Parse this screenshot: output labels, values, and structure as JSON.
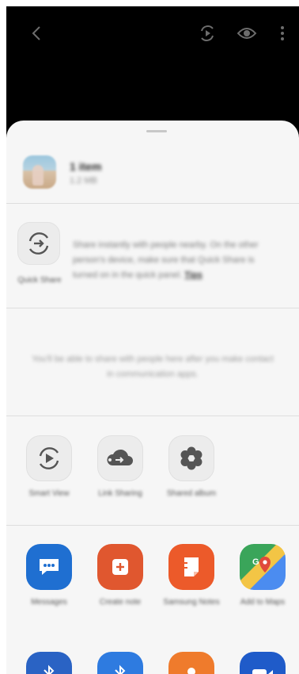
{
  "topbar": {
    "icons": [
      "back-icon",
      "rotate-icon",
      "eye-icon",
      "more-vertical-icon"
    ]
  },
  "file": {
    "title": "1 item",
    "subtitle": "1.2 MB"
  },
  "quick_share": {
    "label": "Quick Share",
    "description": "Share instantly with people nearby. On the other person's device, make sure that Quick Share is turned on in the quick panel.",
    "tips_link": "Tips"
  },
  "contacts": {
    "empty_message": "You'll be able to share with people here after you make contact in communication apps."
  },
  "options": [
    {
      "label": "Smart View",
      "icon": "smart-view-icon"
    },
    {
      "label": "Link Sharing",
      "icon": "link-sharing-icon"
    },
    {
      "label": "Shared album",
      "icon": "shared-album-icon"
    }
  ],
  "apps": [
    {
      "label": "Messages",
      "icon": "messages-icon",
      "color": "#1f6fd1"
    },
    {
      "label": "Create note",
      "icon": "create-note-icon",
      "color": "#e0572f"
    },
    {
      "label": "Samsung Notes",
      "icon": "samsung-notes-icon",
      "color": "#ec5a2a"
    },
    {
      "label": "Add to Maps",
      "icon": "maps-icon",
      "color": "#4aa54a"
    }
  ],
  "apps_row2": [
    {
      "icon": "bluetooth-icon",
      "color": "#2a63c4"
    },
    {
      "icon": "bluetooth-icon",
      "color": "#2e7be0"
    },
    {
      "icon": "contact-icon",
      "color": "#ef7b2c"
    },
    {
      "icon": "video-icon",
      "color": "#1f5bc9"
    }
  ]
}
